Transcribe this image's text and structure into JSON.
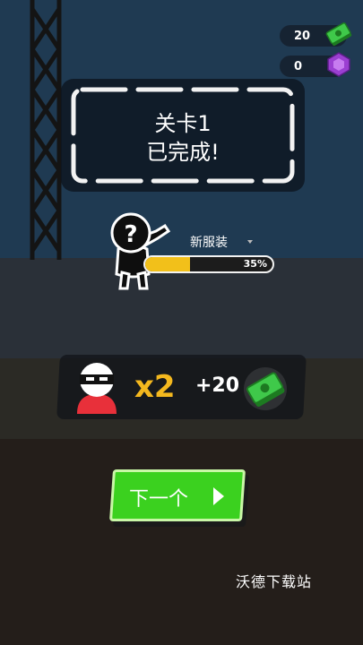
{
  "hud": {
    "cash_count": "20",
    "gem_count": "0",
    "cash_icon": "cash-icon",
    "gem_icon": "gem-icon"
  },
  "level_panel": {
    "title": "关卡1",
    "status": "已完成!"
  },
  "unlock": {
    "label": "新服装",
    "progress_text": "35%",
    "progress_fraction": 0.35
  },
  "reward": {
    "multiplier": "x2",
    "amount": "+20"
  },
  "next_button": {
    "label": "下一个"
  },
  "watermark": "沃德下载站",
  "colors": {
    "accent_green": "#3bd11f",
    "progress_yellow": "#f2c01a",
    "multiplier_orange": "#f4b81e",
    "gem_purple": "#9b3fd1"
  }
}
